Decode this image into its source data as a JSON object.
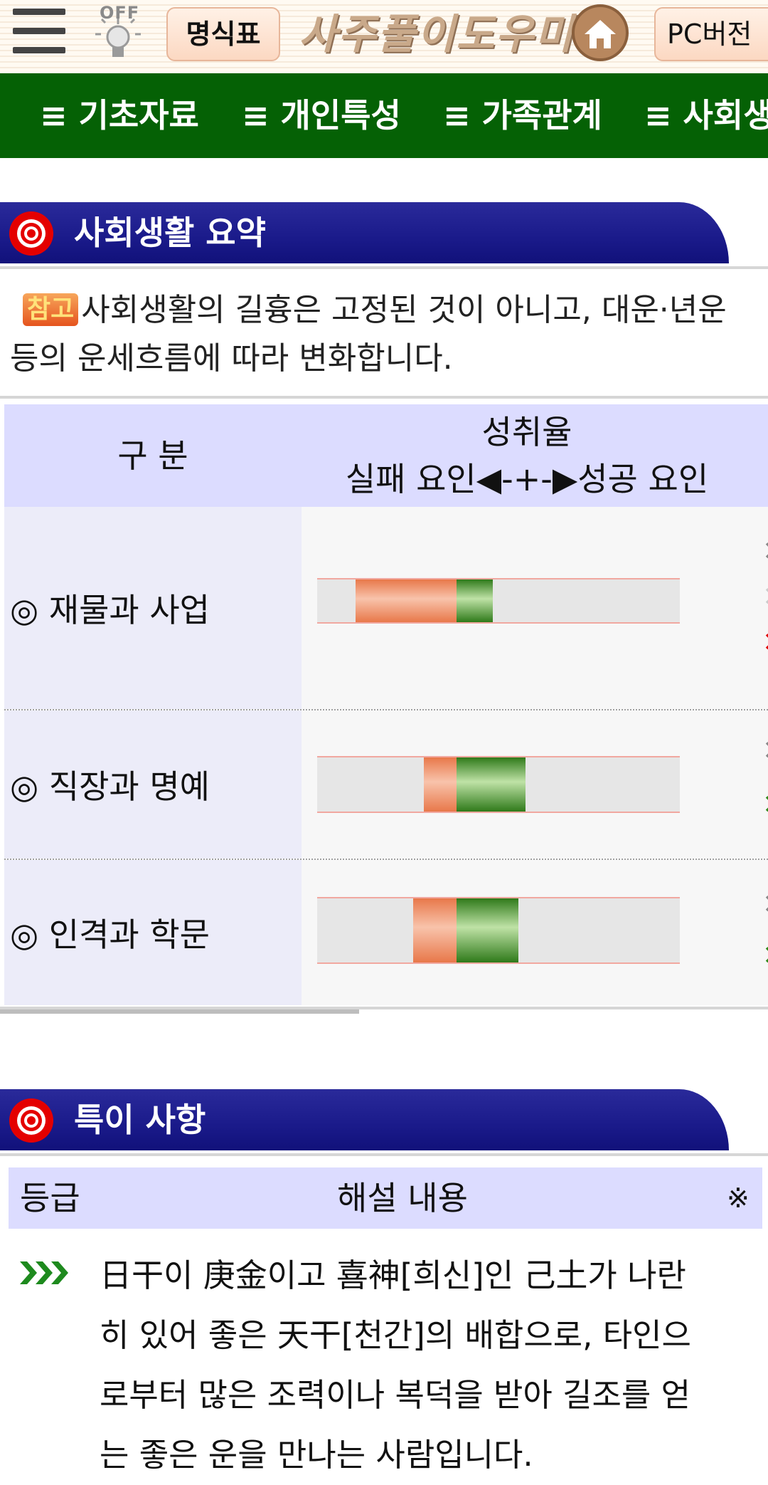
{
  "header": {
    "light_toggle_label": "OFF",
    "myeongsik_button": "명식표",
    "logo_text": "사주풀이도우미",
    "pc_button": "PC버전"
  },
  "nav": {
    "items": [
      "≡ 기초자료",
      "≡ 개인특성",
      "≡ 가족관계",
      "≡ 사회생"
    ]
  },
  "social_summary": {
    "title": "사회생활 요약",
    "note_tag": "참고",
    "note_text": "사회생활의 길흉은 고정된 것이 아니고, 대운·년운 등의 운세흐름에 따라 변화합니다.",
    "table_header": {
      "category": "구 분",
      "rate": "성취율",
      "rate_legend": "실패 요인◀-+-▶성공 요인"
    },
    "rows": [
      {
        "label": "◎ 재물과 사업",
        "fail_factor": 0.28,
        "success_factor": 0.1
      },
      {
        "label": "◎ 직장과 명예",
        "fail_factor": 0.09,
        "success_factor": 0.19
      },
      {
        "label": "◎ 인격과 학문",
        "fail_factor": 0.12,
        "success_factor": 0.17
      }
    ]
  },
  "special": {
    "title": "특이 사항",
    "table_header": {
      "grade": "등급",
      "content": "해설 내용",
      "mark": "※"
    },
    "entry_text": "日干이 庚金이고 喜神[희신]인 己土가 나란히 있어 좋은 天干[천간]의 배합으로, 타인으로부터 많은 조력이나 복덕을 받아 길조를 얻는 좋은 운을 만나는 사람입니다."
  },
  "colors": {
    "nav_bg": "#056105",
    "section_head_bg": "#1a1a8a",
    "table_head_bg": "#dcdcff",
    "fail_bar": "#e8784a",
    "success_bar": "#2f7a1a"
  }
}
